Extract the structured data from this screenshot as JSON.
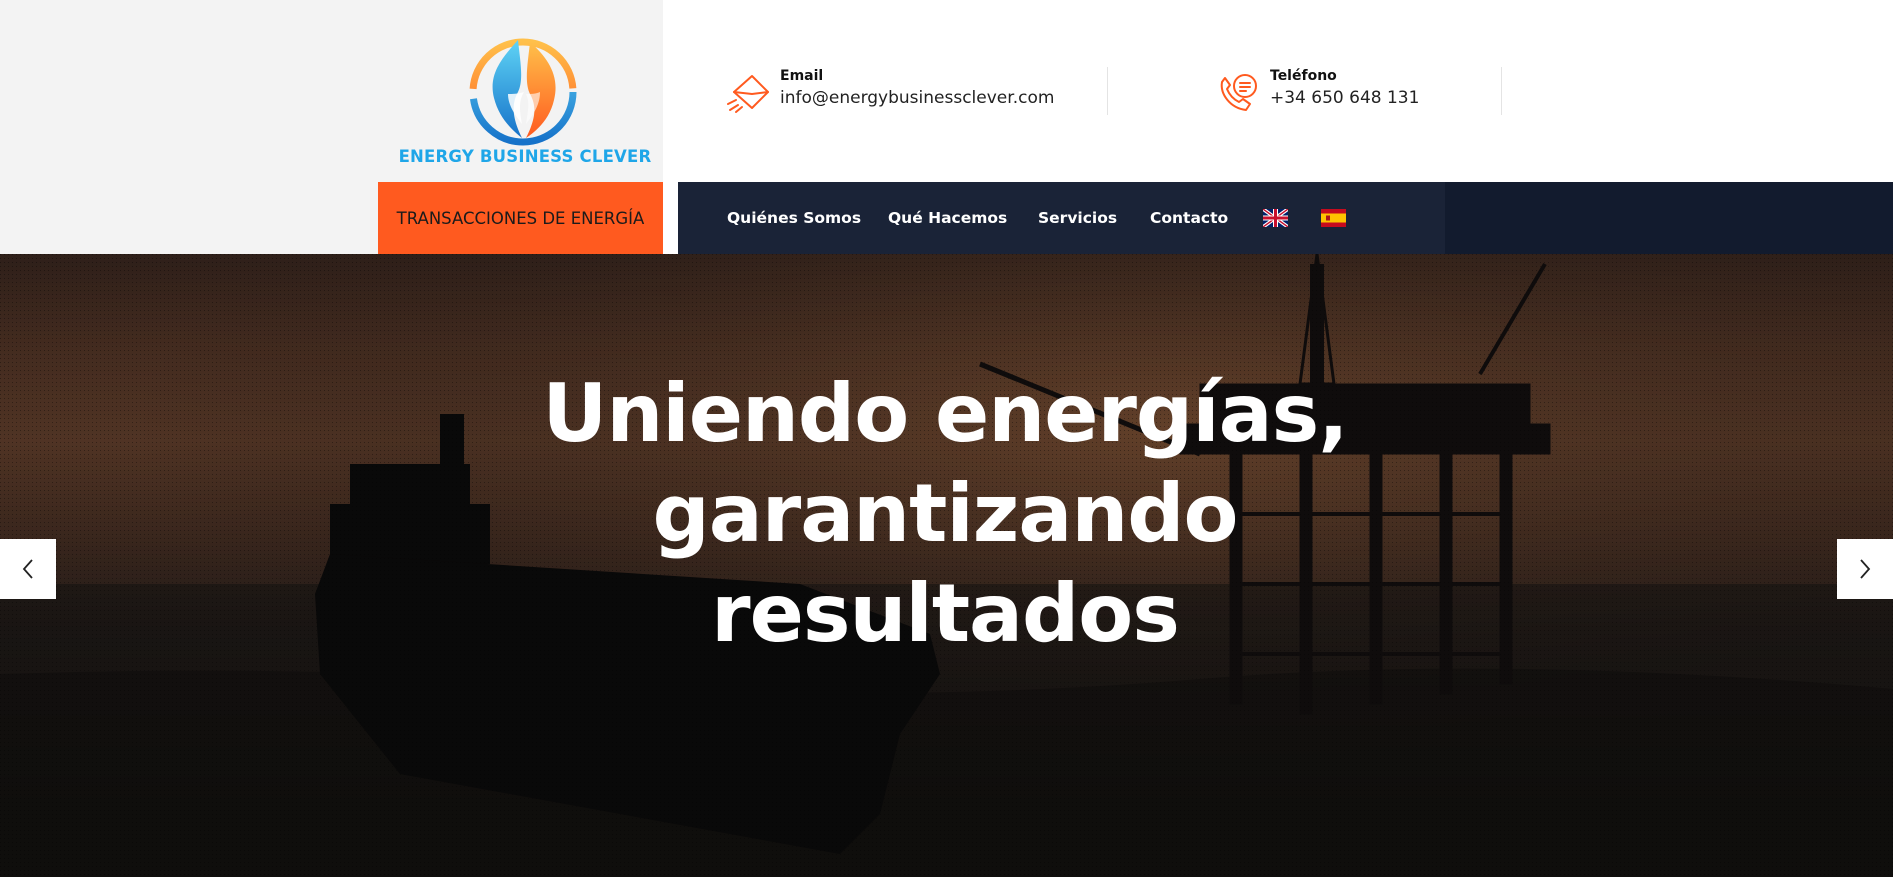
{
  "brand": {
    "name": "ENERGY BUSINESS CLEVER",
    "colors": {
      "accent": "#ff5a1f",
      "nav_bg": "#1a2337",
      "logo_blue": "#1fa6e8"
    }
  },
  "contact": {
    "email": {
      "label": "Email",
      "value": "info@energybusinessclever.com",
      "icon": "email-send-icon"
    },
    "phone": {
      "label": "Teléfono",
      "value": "+34 650 648 131",
      "icon": "phone-chat-icon"
    }
  },
  "cta": {
    "label": "TRANSACCIONES DE ENERGÍA"
  },
  "nav": {
    "items": [
      "Quiénes Somos",
      "Qué Hacemos",
      "Servicios",
      "Contacto"
    ],
    "languages": [
      "english-flag-icon",
      "spanish-flag-icon"
    ]
  },
  "hero": {
    "title_line1": "Uniendo energías,",
    "title_line2": "garantizando",
    "title_line3": "resultados",
    "prev_icon": "chevron-left-icon",
    "next_icon": "chevron-right-icon"
  }
}
